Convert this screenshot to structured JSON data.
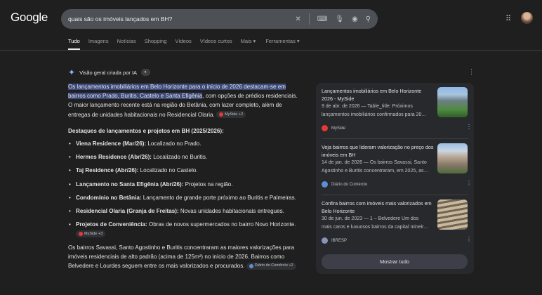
{
  "header": {
    "logo": "Google",
    "query": "quais são os imóveis lançados em BH?"
  },
  "tabs": [
    "Tudo",
    "Imagens",
    "Notícias",
    "Shopping",
    "Vídeos",
    "Vídeos curtos",
    "Mais ▾",
    "Ferramentas ▾"
  ],
  "ai": {
    "title": "Visão geral criada por IA",
    "intro_highlight": "Os lançamentos imobiliários em Belo Horizonte para o início de 2026 destacam-se em bairros como Prado, Buritis, Castelo e Santa Efigênia",
    "intro_rest": ", com opções de prédios residenciais. O maior lançamento recente está na região do Betânia, com lazer completo, além de entregas de unidades habitacionais no Residencial Olaria.",
    "chip1": "MySide +2",
    "heading": "Destaques de lançamentos e projetos em BH (2025/2026):",
    "items": [
      {
        "b": "Viena Residence (Mar/26):",
        "t": " Localizado no Prado."
      },
      {
        "b": "Hermes Residence (Abr/26):",
        "t": " Localizado no Buritis."
      },
      {
        "b": "Taj Residence (Abr/26):",
        "t": " Localizado no Castelo."
      },
      {
        "b": "Lançamento no Santa Efigênia (Abr/26):",
        "t": " Projetos na região."
      },
      {
        "b": "Condomínio no Betânia:",
        "t": " Lançamento de grande porte próximo ao Buritis e Palmeiras."
      },
      {
        "b": "Residencial Olaria (Granja de Freitas):",
        "t": " Novas unidades habitacionais entregues."
      },
      {
        "b": "Projetos de Conveniência:",
        "t": " Obras de novos supermercados no bairro Novo Horizonte.",
        "chip": "MySide +3"
      }
    ],
    "para": "Os bairros Savassi, Santo Agostinho e Buritis concentraram as maiores valorizações para imóveis residenciais de alto padrão (acima de 125m²) no início de 2026. Bairros como Belvedere e Lourdes seguem entre os mais valorizados e procurados.",
    "chip2": "Diário do Comércio +2"
  },
  "sources": [
    {
      "title": "Lançamentos imobiliários em Belo Horizonte 2026 - MySide",
      "snippet1": "9 de abr. de 2026 — Table_title: Próximos",
      "snippet2": "lançamentos imobiliários confirmados para 20…",
      "site": "MySide",
      "color": "#e53935"
    },
    {
      "title": "Veja bairros que lideram valorização no preço dos imóveis em BH",
      "snippet1": "14 de jan. de 2026 — Os bairros Savassi, Santo",
      "snippet2": "Agostinho e Buritis concentraram, em 2025, as…",
      "site": "Diário do Comércio",
      "color": "#5b8fd6"
    },
    {
      "title": "Confira bairros com imóveis mais valorizados em Belo Horizonte",
      "snippet1": "30 de jun. de 2023 — 1 – Belvedere Um dos",
      "snippet2": "mais caros e luxuosos bairros da capital mineir…",
      "site": "IBRESP",
      "color": "#8a93b8"
    }
  ],
  "show_all": "Mostrar tudo"
}
